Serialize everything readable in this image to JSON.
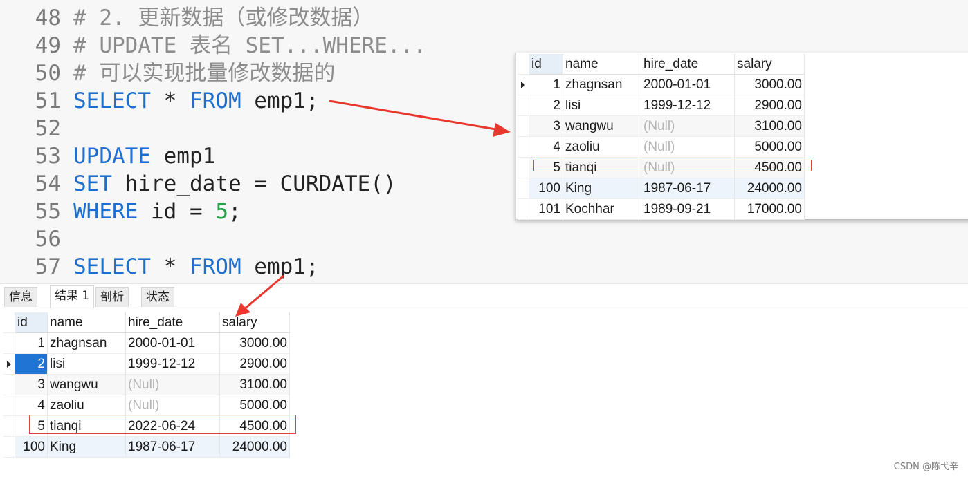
{
  "editor": {
    "lines": [
      {
        "num": "48",
        "tokens": [
          {
            "t": "# 2. 更新数据（或修改数据）",
            "c": "cm"
          }
        ]
      },
      {
        "num": "49",
        "tokens": [
          {
            "t": "# UPDATE 表名 SET...WHERE...",
            "c": "cm"
          }
        ]
      },
      {
        "num": "50",
        "tokens": [
          {
            "t": "# 可以实现批量修改数据的",
            "c": "cm"
          }
        ]
      },
      {
        "num": "51",
        "tokens": [
          {
            "t": "SELECT",
            "c": "kw"
          },
          {
            "t": " * ",
            "c": "txt"
          },
          {
            "t": "FROM",
            "c": "kw"
          },
          {
            "t": " emp1;",
            "c": "txt"
          }
        ]
      },
      {
        "num": "52",
        "tokens": []
      },
      {
        "num": "53",
        "tokens": [
          {
            "t": "UPDATE",
            "c": "kw"
          },
          {
            "t": " emp1",
            "c": "txt"
          }
        ]
      },
      {
        "num": "54",
        "tokens": [
          {
            "t": "SET",
            "c": "kw"
          },
          {
            "t": " hire_date = CURDATE()",
            "c": "txt"
          }
        ]
      },
      {
        "num": "55",
        "tokens": [
          {
            "t": "WHERE",
            "c": "kw"
          },
          {
            "t": " id = ",
            "c": "txt"
          },
          {
            "t": "5",
            "c": "num"
          },
          {
            "t": ";",
            "c": "txt"
          }
        ]
      },
      {
        "num": "56",
        "tokens": []
      },
      {
        "num": "57",
        "tokens": [
          {
            "t": "SELECT",
            "c": "kw"
          },
          {
            "t": " * ",
            "c": "txt"
          },
          {
            "t": "FROM",
            "c": "kw"
          },
          {
            "t": " emp1;",
            "c": "txt"
          }
        ]
      }
    ]
  },
  "top_grid": {
    "columns": [
      "id",
      "name",
      "hire_date",
      "salary"
    ],
    "rows": [
      [
        "1",
        "zhagnsan",
        "2000-01-01",
        "3000.00"
      ],
      [
        "2",
        "lisi",
        "1999-12-12",
        "2900.00"
      ],
      [
        "3",
        "wangwu",
        "(Null)",
        "3100.00"
      ],
      [
        "4",
        "zaoliu",
        "(Null)",
        "5000.00"
      ],
      [
        "5",
        "tianqi",
        "(Null)",
        "4500.00"
      ],
      [
        "100",
        "King",
        "1987-06-17",
        "24000.00"
      ],
      [
        "101",
        "Kochhar",
        "1989-09-21",
        "17000.00"
      ]
    ]
  },
  "results": {
    "tabs": [
      "信息",
      "结果 1",
      "剖析",
      "状态"
    ],
    "active_tab": "结果 1",
    "columns": [
      "id",
      "name",
      "hire_date",
      "salary"
    ],
    "rows": [
      [
        "1",
        "zhagnsan",
        "2000-01-01",
        "3000.00"
      ],
      [
        "2",
        "lisi",
        "1999-12-12",
        "2900.00"
      ],
      [
        "3",
        "wangwu",
        "(Null)",
        "3100.00"
      ],
      [
        "4",
        "zaoliu",
        "(Null)",
        "5000.00"
      ],
      [
        "5",
        "tianqi",
        "2022-06-24",
        "4500.00"
      ],
      [
        "100",
        "King",
        "1987-06-17",
        "24000.00"
      ]
    ]
  },
  "colors": {
    "keyword": "#1f6fd1",
    "number": "#23a34a",
    "comment": "#8c8c8c",
    "highlight_box": "#e0443c",
    "selection": "#1f74d4"
  },
  "watermark": "CSDN @陈弋辛"
}
